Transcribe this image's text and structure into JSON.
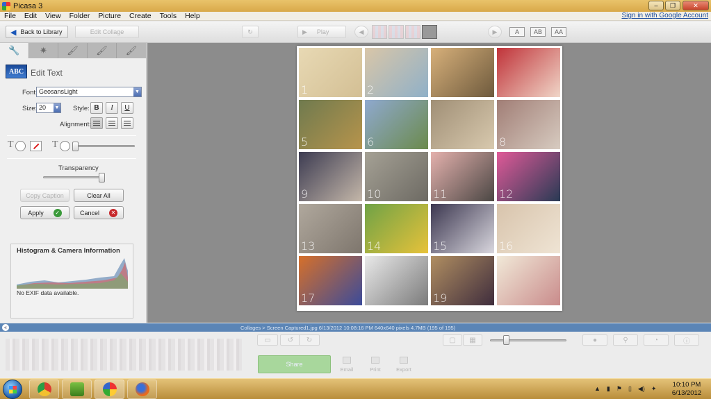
{
  "window": {
    "title": "Picasa 3"
  },
  "menu": {
    "items": [
      "File",
      "Edit",
      "View",
      "Folder",
      "Picture",
      "Create",
      "Tools",
      "Help"
    ],
    "signin": "Sign in with Google Account"
  },
  "toolbar": {
    "back_label": "Back to Library",
    "edit_collage_label": "Edit Collage",
    "play_label": "Play",
    "text_sizes": [
      "A",
      "AB",
      "AA"
    ]
  },
  "leftpanel": {
    "tabs": [
      "wrench-icon",
      "sparkle-icon",
      "brush-icon",
      "brush-icon",
      "brush-icon"
    ],
    "edit_text": {
      "icon_text": "ABC",
      "title": "Edit Text"
    },
    "font_label": "Font:",
    "font_value": "GeosansLight",
    "size_label": "Size:",
    "size_value": "20",
    "style_label": "Style:",
    "bold": "B",
    "italic": "I",
    "underline": "U",
    "alignment_label": "Alignment:",
    "transparency_label": "Transparency",
    "transparency_value": 1.0,
    "copy_caption_label": "Copy Caption",
    "clear_all_label": "Clear All",
    "apply_label": "Apply",
    "cancel_label": "Cancel",
    "histogram": {
      "title": "Histogram & Camera Information",
      "no_exif": "No EXIF data available."
    }
  },
  "collage": {
    "numbers": [
      "1",
      "2",
      "",
      "",
      "5",
      "6",
      "",
      "8",
      "9",
      "10",
      "11",
      "12",
      "13",
      "14",
      "15",
      "16",
      "17",
      "",
      "19",
      ""
    ],
    "cell_colors": [
      [
        "#e8d9b4",
        "#d3bf94"
      ],
      [
        "#d9c6a8",
        "#8fb0c8"
      ],
      [
        "#d7b07a",
        "#6e5a3d"
      ],
      [
        "#c03339",
        "#f0d6c8"
      ],
      [
        "#6f7a4e",
        "#b7944c"
      ],
      [
        "#8fa9cf",
        "#6b8a4c"
      ],
      [
        "#a08f76",
        "#d8c9ae"
      ],
      [
        "#a17e76",
        "#d7cbc0"
      ],
      [
        "#3d3c52",
        "#c4b7a9"
      ],
      [
        "#a5a195",
        "#6d6a63"
      ],
      [
        "#e4b1ad",
        "#4b4744"
      ],
      [
        "#e05a98",
        "#283a54"
      ],
      [
        "#b0a89d",
        "#7e766d"
      ],
      [
        "#6fa246",
        "#e7c23a"
      ],
      [
        "#3c3750",
        "#d9d7de"
      ],
      [
        "#d8c4ac",
        "#efe4d4"
      ],
      [
        "#d6702a",
        "#3b4b9a"
      ],
      [
        "#e9e9e9",
        "#7b7b7b"
      ],
      [
        "#b08e61",
        "#3f2d3d"
      ],
      [
        "#f1e9d8",
        "#c98b8b"
      ]
    ]
  },
  "statusbar": {
    "text": "Collages > Screen Captured1.jpg     6/13/2012 10:08:16 PM     640x640 pixels     4.7MB     (195 of 195)"
  },
  "tray": {
    "share_label": "Share",
    "email_label": "Email",
    "print_label": "Print",
    "export_label": "Export"
  },
  "taskbar": {
    "time": "10:10 PM",
    "date": "6/13/2012"
  }
}
